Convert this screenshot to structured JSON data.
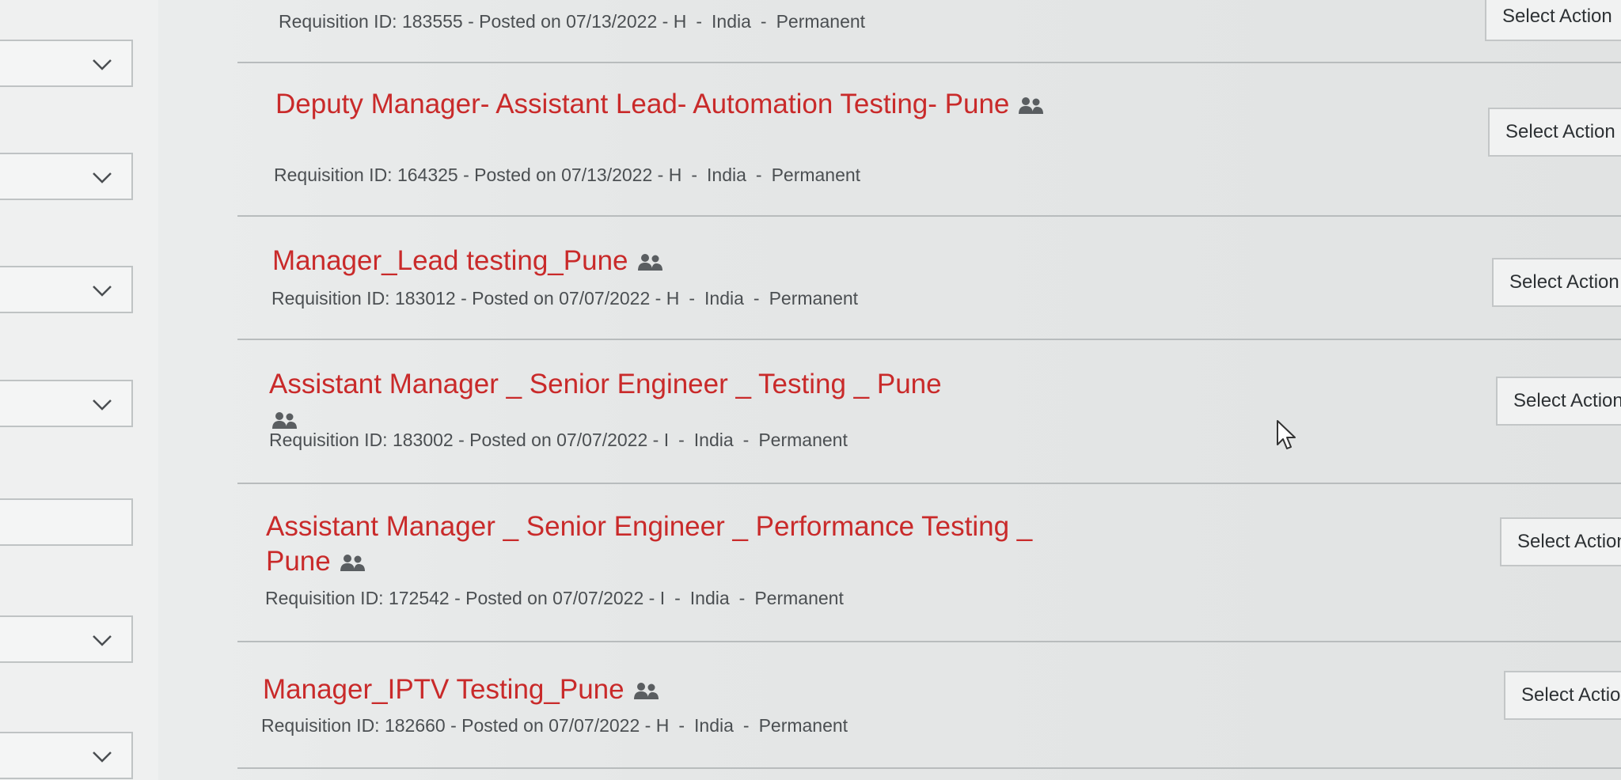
{
  "filters": {
    "count": 7
  },
  "jobs": [
    {
      "title": "",
      "meta": {
        "requisition": "Requisition ID: 183555",
        "posted": "Posted on 07/13/2022",
        "type": "H",
        "country": "India",
        "employment": "Permanent"
      },
      "action": "Select Action"
    },
    {
      "title": "Deputy Manager- Assistant Lead- Automation Testing- Pune",
      "meta": {
        "requisition": "Requisition ID: 164325",
        "posted": "Posted on 07/13/2022",
        "type": "H",
        "country": "India",
        "employment": "Permanent"
      },
      "action": "Select Action"
    },
    {
      "title": "Manager_Lead testing_Pune",
      "meta": {
        "requisition": "Requisition ID: 183012",
        "posted": "Posted on 07/07/2022",
        "type": "H",
        "country": "India",
        "employment": "Permanent"
      },
      "action": "Select Action"
    },
    {
      "title": "Assistant Manager _ Senior Engineer _ Testing _ Pune",
      "meta": {
        "requisition": "Requisition ID: 183002",
        "posted": "Posted on 07/07/2022",
        "type": "I",
        "country": "India",
        "employment": "Permanent"
      },
      "action": "Select Action"
    },
    {
      "title": "Assistant Manager _ Senior Engineer _ Performance Testing _ Pune",
      "meta": {
        "requisition": "Requisition ID: 172542",
        "posted": "Posted on 07/07/2022",
        "type": "I",
        "country": "India",
        "employment": "Permanent"
      },
      "action": "Select Action"
    },
    {
      "title": "Manager_IPTV Testing_Pune",
      "meta": {
        "requisition": "Requisition ID: 182660",
        "posted": "Posted on 07/07/2022",
        "type": "H",
        "country": "India",
        "employment": "Permanent"
      },
      "action": "Select Action"
    }
  ],
  "icons": {
    "people": "people-icon",
    "chevron": "chevron-down-icon",
    "cursor": "mouse-cursor-icon"
  },
  "colors": {
    "title": "#c92a2a",
    "meta": "#4b4f52"
  }
}
